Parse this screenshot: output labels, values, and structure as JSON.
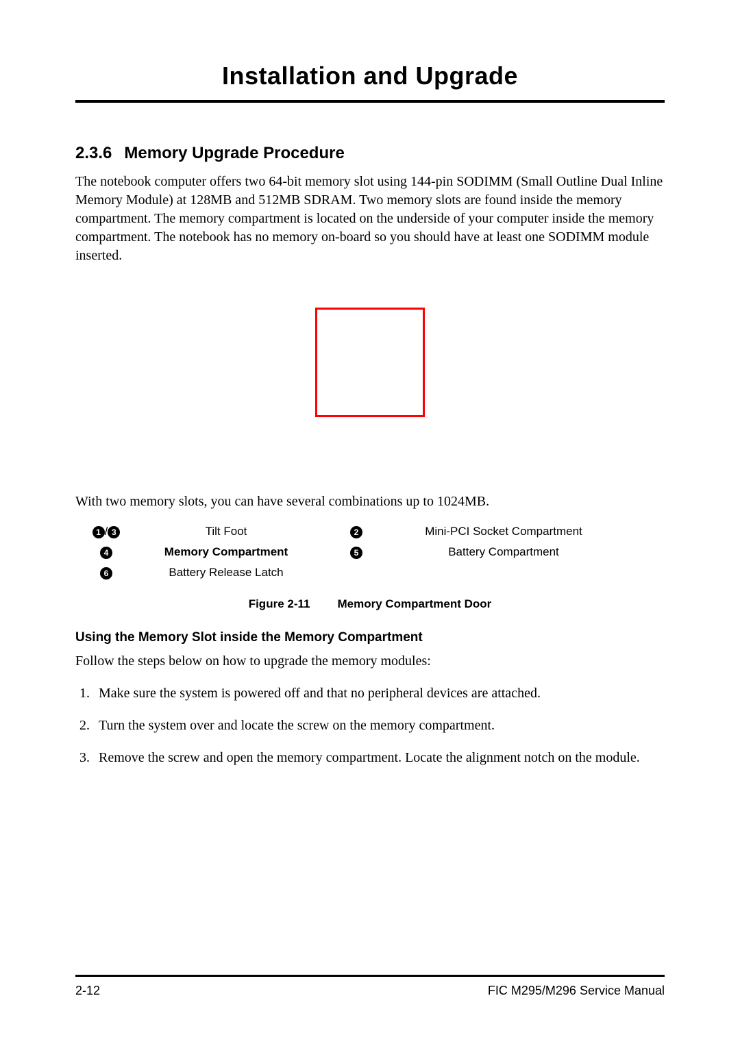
{
  "title": "Installation and Upgrade",
  "section": {
    "number": "2.3.6",
    "heading": "Memory Upgrade Procedure",
    "para1": "The notebook computer offers two 64-bit memory slot using 144-pin SODIMM (Small Outline Dual Inline Memory Module) at 128MB and 512MB SDRAM. Two memory slots are found inside the memory compartment. The memory compartment is located on the underside of your computer inside the memory compartment. The notebook has no memory on-board so you should have at least one SODIMM module inserted.",
    "para2": "With two memory slots, you can have several combinations up to 1024MB."
  },
  "legend": {
    "rows": [
      {
        "m1a": "1",
        "m1b": "3",
        "l1": "Tilt Foot",
        "m2": "2",
        "l2": "Mini-PCI Socket Compartment",
        "bold": false
      },
      {
        "m1a": "4",
        "m1b": "",
        "l1": "Memory Compartment",
        "m2": "5",
        "l2": "Battery Compartment",
        "bold": true
      },
      {
        "m1a": "6",
        "m1b": "",
        "l1": "Battery Release Latch",
        "m2": "",
        "l2": "",
        "bold": false
      }
    ]
  },
  "figure": {
    "number": "Figure 2-11",
    "title": "Memory Compartment Door"
  },
  "subheading": "Using the Memory Slot inside the Memory Compartment",
  "para3": "Follow the steps below on how to upgrade the memory modules:",
  "steps": [
    "Make sure the system is powered off and that no peripheral devices are attached.",
    "Turn the system over and locate the screw on the memory compartment.",
    "Remove the screw and open the memory compartment. Locate the alignment notch on the module."
  ],
  "footer": {
    "page": "2-12",
    "doc": "FIC M295/M296 Service Manual"
  }
}
